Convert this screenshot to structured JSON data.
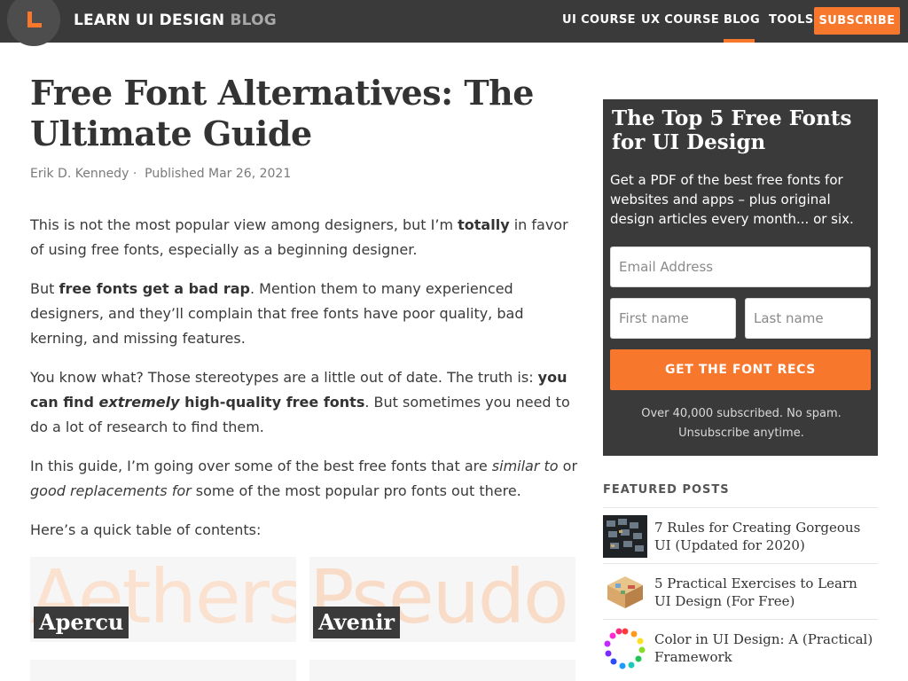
{
  "header": {
    "brand_main": "LEARN UI DESIGN",
    "brand_sub": "BLOG",
    "nav": [
      "UI COURSE",
      "UX COURSE",
      "BLOG",
      "TOOLS"
    ],
    "subscribe_label": "SUBSCRIBE",
    "accent_color": "#f7772d"
  },
  "article": {
    "title": "Free Font Alternatives: The Ultimate Guide",
    "author": "Erik D. Kennedy",
    "separator": "·",
    "published": "Published Mar 26, 2021",
    "p1": {
      "a": "This is not the most popular view among designers, but I’m ",
      "b": "totally",
      "c": " in favor of using free fonts, especially as a beginning designer."
    },
    "p2": {
      "a": "But ",
      "b": "free fonts get a bad rap",
      "c": ". Mention them to many experienced designers, and they’ll complain that free fonts have poor quality, bad kerning, and missing features."
    },
    "p3": {
      "a": "You know what? Those stereotypes are a little out of date. The truth is: ",
      "b": "you can find ",
      "bi": "extremely",
      "b2": " high-quality free fonts",
      "c": ". But sometimes you need to do a lot of research to find them."
    },
    "p4": {
      "a": "In this guide, I’m going over some of the best free fonts that are ",
      "i1": "similar to",
      "b": " or ",
      "i2": "good replacements for",
      "c": " some of the most popular pro fonts out there."
    },
    "p5": "Here’s a quick table of contents:",
    "cards": [
      {
        "label": "Apercu",
        "bg_word": "Aethers"
      },
      {
        "label": "Avenir",
        "bg_word": "Pseudo"
      }
    ]
  },
  "sidebar": {
    "signup_title": "The Top 5 Free Fonts for UI Design",
    "signup_desc": "Get a PDF of the best free fonts for websites and apps – plus original design articles every month... or six.",
    "email_placeholder": "Email Address",
    "first_placeholder": "First name",
    "last_placeholder": "Last name",
    "cta_label": "GET THE FONT RECS",
    "note": "Over 40,000 subscribed. No spam. Unsubscribe anytime.",
    "featured_heading": "FEATURED POSTS",
    "featured": [
      {
        "title": "7 Rules for Creating Gorgeous UI (Updated for 2020)",
        "thumb": "ui-screens-thumbnail"
      },
      {
        "title": "5 Practical Exercises to Learn UI Design (For Free)",
        "thumb": "isometric-room-thumbnail"
      },
      {
        "title": "Color in UI Design: A (Practical) Framework",
        "thumb": "color-wheel-thumbnail"
      }
    ]
  }
}
